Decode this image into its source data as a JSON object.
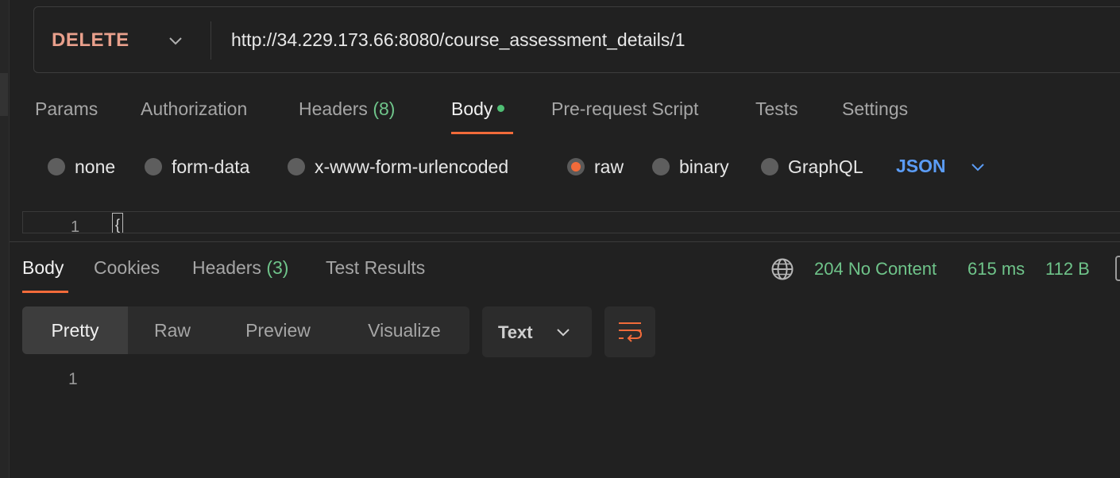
{
  "request": {
    "method": "DELETE",
    "url": "http://34.229.173.66:8080/course_assessment_details/1"
  },
  "request_tabs": {
    "params": "Params",
    "authorization": "Authorization",
    "headers": "Headers",
    "headers_count": "(8)",
    "body": "Body",
    "pre_request": "Pre-request Script",
    "tests": "Tests",
    "settings": "Settings"
  },
  "body_modes": {
    "none": "none",
    "form_data": "form-data",
    "urlencoded": "x-www-form-urlencoded",
    "raw": "raw",
    "binary": "binary",
    "graphql": "GraphQL",
    "selected": "raw",
    "language": "JSON"
  },
  "editor": {
    "line_number": "1",
    "content": "{"
  },
  "response_tabs": {
    "body": "Body",
    "cookies": "Cookies",
    "headers": "Headers",
    "headers_count": "(3)",
    "test_results": "Test Results"
  },
  "response_meta": {
    "status": "204 No Content",
    "time": "615 ms",
    "size": "112 B"
  },
  "view_modes": {
    "pretty": "Pretty",
    "raw": "Raw",
    "preview": "Preview",
    "visualize": "Visualize",
    "format": "Text"
  },
  "response_body": {
    "line_number": "1"
  },
  "colors": {
    "accent": "#f26b3a",
    "success": "#6fc48a",
    "method": "#e9a08c",
    "language": "#5b9cf5"
  }
}
